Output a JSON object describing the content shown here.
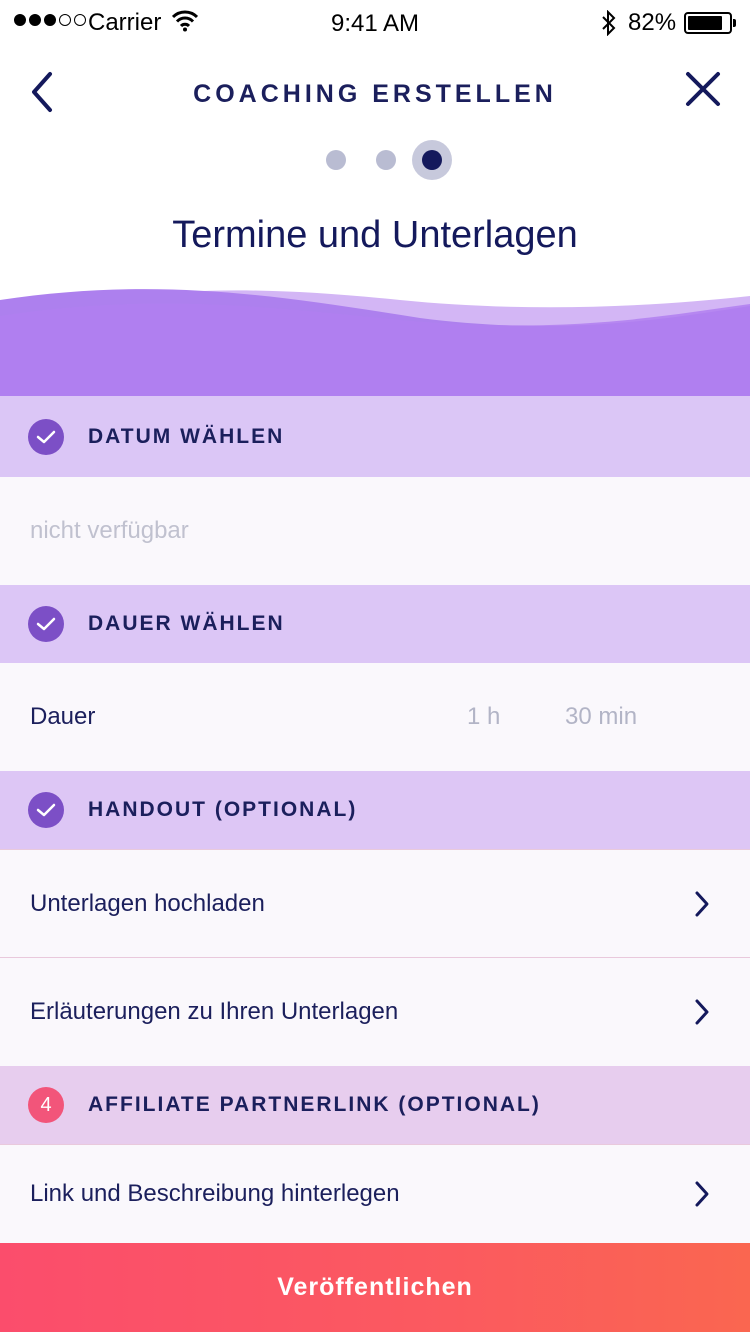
{
  "status_bar": {
    "carrier": "Carrier",
    "time": "9:41 AM",
    "battery": "82%"
  },
  "nav": {
    "title": "COACHING ERSTELLEN",
    "back_icon": "chevron-left-icon",
    "close_icon": "close-icon"
  },
  "steps": {
    "total": 3,
    "current": 3
  },
  "page_title": "Termine und Unterlagen",
  "colors": {
    "primary": "#14195c",
    "accent_purple": "#7c4fc6",
    "section_bg": "#dcc6f5",
    "badge_pink": "#f2557a",
    "cta_start": "#fb4d6c",
    "cta_end": "#fa6650"
  },
  "sections": [
    {
      "label": "DATUM WÄHLEN",
      "badge": "check-icon",
      "rows": [
        {
          "text": "nicht verfügbar"
        }
      ]
    },
    {
      "label": "DAUER WÄHLEN",
      "badge": "check-icon",
      "rows": [
        {
          "text": "Dauer",
          "hours": "1 h",
          "minutes": "30 min"
        }
      ]
    },
    {
      "label": "HANDOUT (OPTIONAL)",
      "badge": "check-icon",
      "rows": [
        {
          "text": "Unterlagen hochladen"
        },
        {
          "text": "Erläuterungen zu Ihren Unterlagen"
        }
      ]
    },
    {
      "label": "AFFILIATE PARTNERLINK (OPTIONAL)",
      "badge_number": "4",
      "rows": [
        {
          "text": "Link und Beschreibung hinterlegen"
        }
      ]
    }
  ],
  "cta": {
    "label": "Veröffentlichen"
  }
}
